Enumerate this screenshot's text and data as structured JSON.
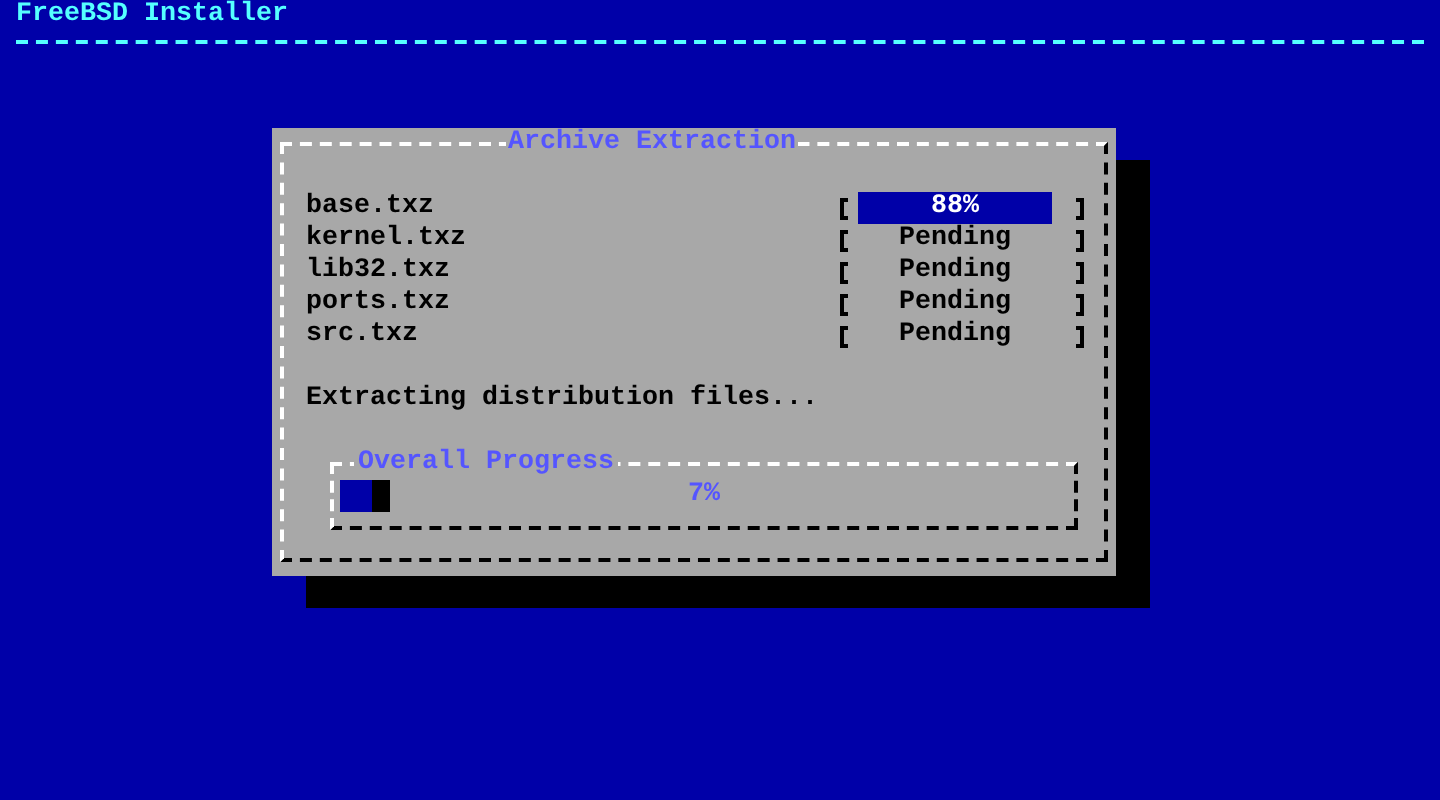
{
  "header": {
    "title": "FreeBSD Installer"
  },
  "dialog": {
    "title": "Archive Extraction",
    "files": [
      {
        "name": "base.txz",
        "status": "88%",
        "kind": "progress"
      },
      {
        "name": "kernel.txz",
        "status": "Pending",
        "kind": "pending"
      },
      {
        "name": "lib32.txz",
        "status": "Pending",
        "kind": "pending"
      },
      {
        "name": "ports.txz",
        "status": "Pending",
        "kind": "pending"
      },
      {
        "name": "src.txz",
        "status": "Pending",
        "kind": "pending"
      }
    ],
    "message": "Extracting distribution files...",
    "overall": {
      "title": "Overall Progress",
      "reading": "7%",
      "level": 0.07
    }
  }
}
